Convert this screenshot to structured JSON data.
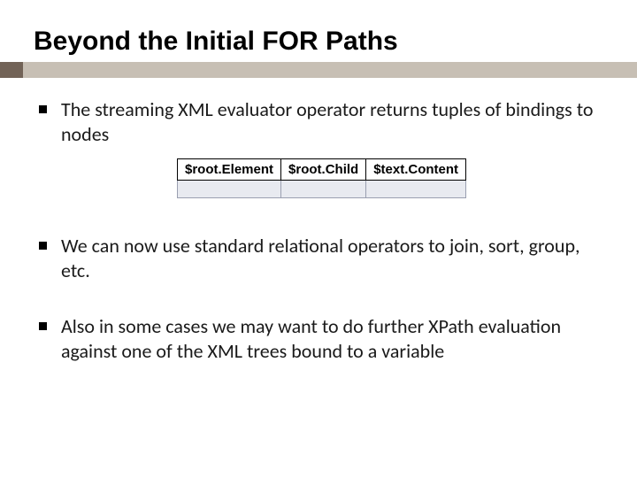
{
  "title": "Beyond the Initial FOR Paths",
  "bullets": [
    "The streaming XML evaluator operator returns tuples of bindings to nodes",
    "We can now use standard relational operators to join, sort, group, etc.",
    "Also in some cases we may want to do further XPath evaluation against one of the XML trees bound to a variable"
  ],
  "table": {
    "headers": [
      "$root.Element",
      "$root.Child",
      "$text.Content"
    ],
    "rows": [
      [
        "",
        "",
        ""
      ]
    ]
  }
}
